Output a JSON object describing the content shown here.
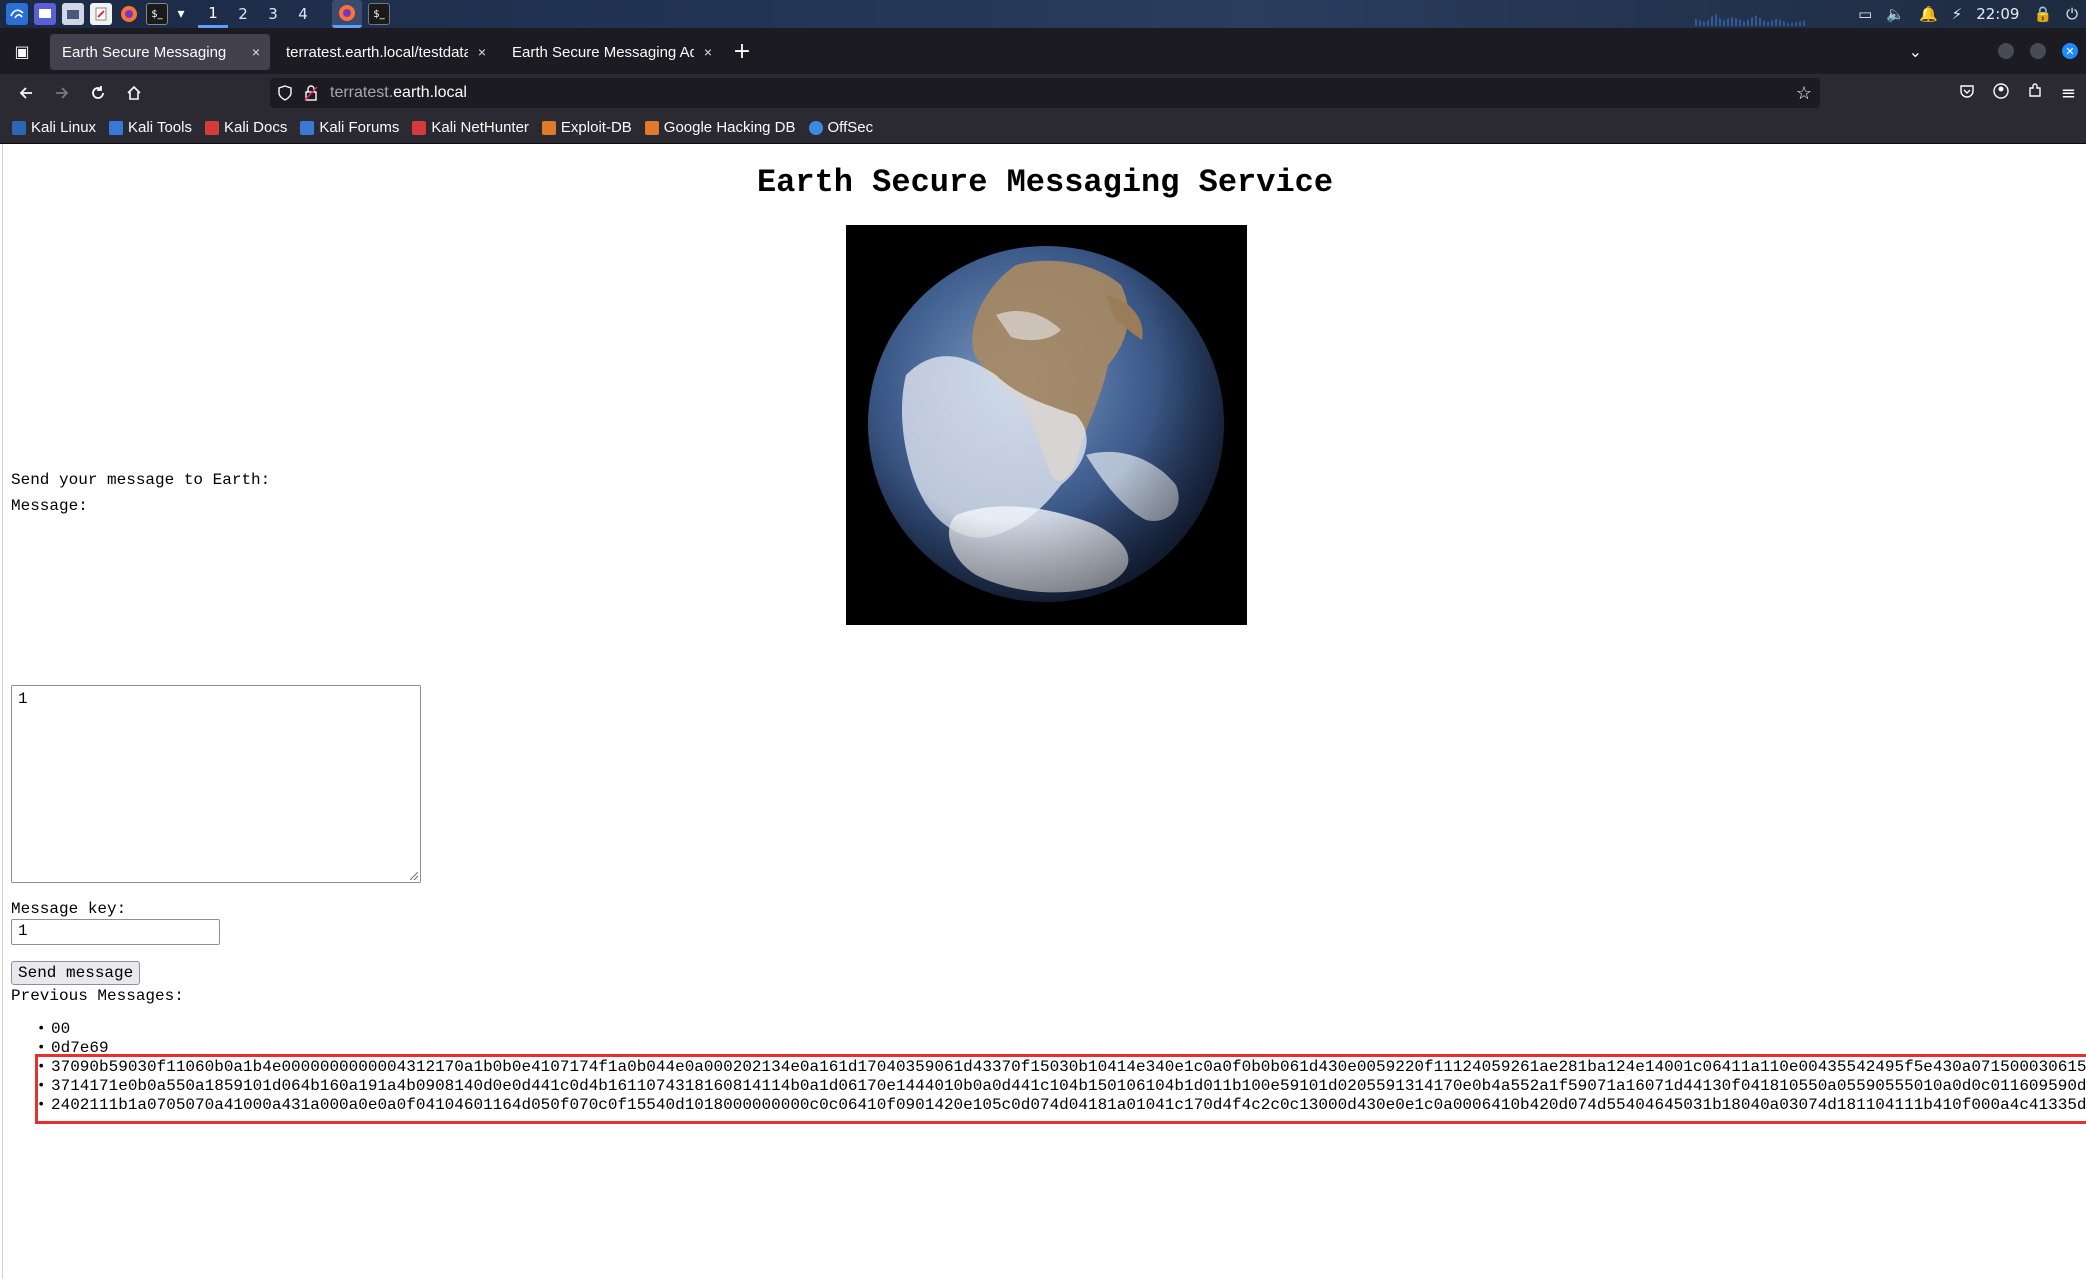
{
  "system_panel": {
    "workspaces": [
      "1",
      "2",
      "3",
      "4"
    ],
    "active_workspace": "1",
    "clock": "22:09"
  },
  "browser": {
    "tabs": [
      {
        "label": "Earth Secure Messaging",
        "active": true
      },
      {
        "label": "terratest.earth.local/testdata",
        "active": false
      },
      {
        "label": "Earth Secure Messaging Adm",
        "active": false
      }
    ],
    "tab_close_glyph": "×",
    "new_tab_glyph": "+",
    "url_prefix": "terratest.",
    "url_host": "earth.local",
    "bookmarks": [
      {
        "label": "Kali Linux",
        "color": "#2b67b3"
      },
      {
        "label": "Kali Tools",
        "color": "#3a79d8"
      },
      {
        "label": "Kali Docs",
        "color": "#d33a3a"
      },
      {
        "label": "Kali Forums",
        "color": "#3a79d8"
      },
      {
        "label": "Kali NetHunter",
        "color": "#d33a3a"
      },
      {
        "label": "Exploit-DB",
        "color": "#e07a28"
      },
      {
        "label": "Google Hacking DB",
        "color": "#e07a28"
      },
      {
        "label": "OffSec",
        "color": "#3a8ae0"
      }
    ]
  },
  "page": {
    "title": "Earth Secure Messaging Service",
    "send_prompt": "Send your message to Earth:",
    "message_label": "Message:",
    "message_value": "1",
    "key_label": "Message key:",
    "key_value": "1",
    "send_button": "Send message",
    "previous_label": "Previous Messages:",
    "messages": [
      "00",
      "0d7e69",
      "37090b59030f11060b0a1b4e0000000000004312170a1b0b0e4107174f1a0b044e0a000202134e0a161d17040359061d43370f15030b10414e340e1c0a0f0b0b061d430e0059220f11124059261ae281ba124e14001c06411a110e00435542495f5e430a0715000306150",
      "3714171e0b0a550a1859101d064b160a191a4b0908140d0e0d441c0d4b1611074318160814114b0a1d06170e1444010b0a0d441c104b150106104b1d011b100e59101d0205591314170e0b4a552a1f59071a16071d44130f041810550a05590555010a0d0c011609590d",
      "2402111b1a0705070a41000a431a000a0e0a0f04104601164d050f070c0f15540d1018000000000c0c06410f0901420e105c0d074d04181a01041c170d4f4c2c0c13000d430e0e1c0a0006410b420d074d55404645031b18040a03074d181104111b410f000a4c41335d"
    ],
    "accent_highlight": "#e53030"
  }
}
